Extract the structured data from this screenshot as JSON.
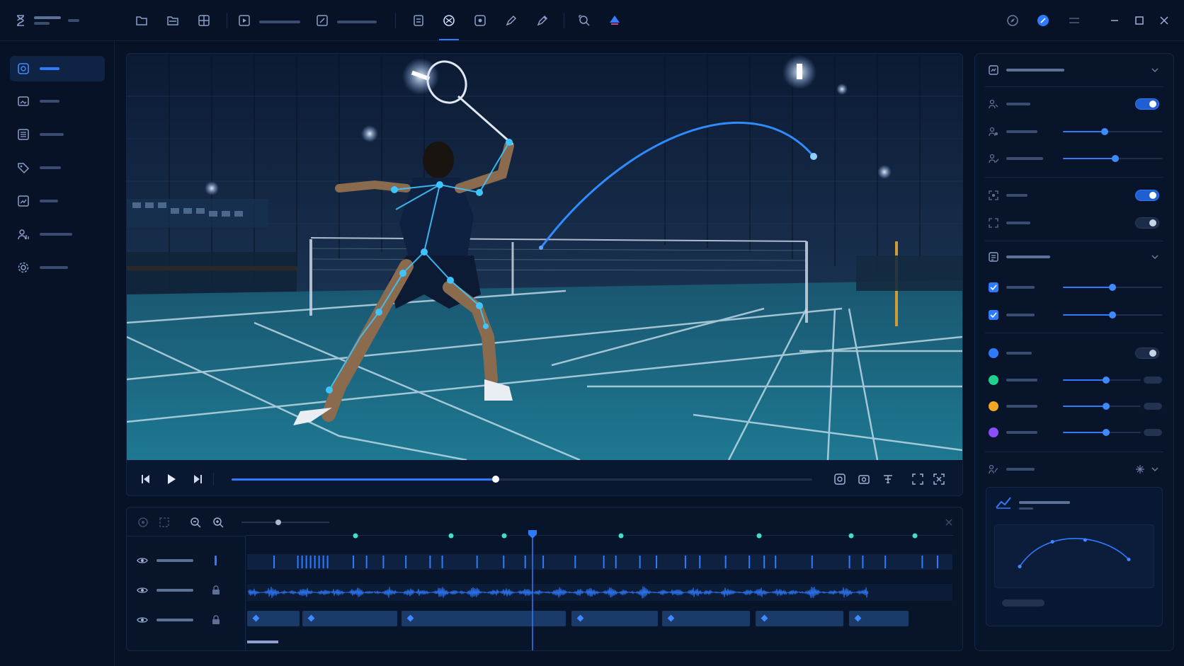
{
  "theme": {
    "background": "#071226",
    "panel": "#081429",
    "accent": "#2f7bff",
    "skeleton_joint": "#3ec5ff",
    "trajectory": "#2f8cff"
  },
  "topbar": {
    "icons": [
      "hourglass-icon",
      "file-icon",
      "folder-open-icon",
      "layout-icon",
      "play-box-icon",
      "edit-box-icon",
      "checklist-icon",
      "pose-detection-icon",
      "target-box-icon",
      "pen-icon",
      "pen-alt-icon",
      "zoom-search-icon",
      "shuttle-icon",
      "compass-icon",
      "help-icon",
      "menu-icon"
    ],
    "window_controls": [
      "minimize-icon",
      "maximize-icon",
      "close-icon"
    ]
  },
  "sidebar": {
    "items": [
      {
        "icon": "dashboard-icon",
        "active": true
      },
      {
        "icon": "image-folder-icon",
        "active": false
      },
      {
        "icon": "list-icon",
        "active": false
      },
      {
        "icon": "tag-icon",
        "active": false
      },
      {
        "icon": "chart-icon",
        "active": false
      },
      {
        "icon": "user-stats-icon",
        "active": false
      },
      {
        "icon": "settings-icon",
        "active": false
      }
    ]
  },
  "player": {
    "progress": 0.455,
    "controls_left": [
      "skip-back-icon",
      "play-icon",
      "skip-forward-icon"
    ],
    "controls_right": [
      "snapshot-icon",
      "camera-settings-icon",
      "adjust-icon",
      "fit-icon",
      "fullscreen-icon"
    ]
  },
  "timeline": {
    "zoom_level": 0.42,
    "playhead_position": 0.405,
    "keyframe_positions": [
      0.155,
      0.29,
      0.365,
      0.53,
      0.725,
      0.855,
      0.945
    ],
    "tracks": [
      {
        "name": "events-track",
        "visible": true,
        "locked": false
      },
      {
        "name": "audio-track",
        "visible": true,
        "locked": true
      },
      {
        "name": "clips-track",
        "visible": true,
        "locked": true
      }
    ]
  },
  "right_panel": {
    "section_1_toggles": [
      true
    ],
    "slider_values": [
      0.42,
      0.53
    ],
    "section_2_toggles": [
      true,
      false
    ],
    "checkbox_sliders": [
      0.5,
      0.5
    ],
    "color_layers": [
      {
        "color": "#2f7bff",
        "value": null
      },
      {
        "color": "#1fd18a",
        "value": 0.55
      },
      {
        "color": "#f5a623",
        "value": 0.55
      },
      {
        "color": "#8a4dff",
        "value": 0.55
      }
    ],
    "trajectory_preview_points": [
      [
        0.0,
        0.25
      ],
      [
        0.3,
        0.95
      ],
      [
        0.6,
        1.0
      ],
      [
        1.0,
        0.45
      ]
    ]
  }
}
